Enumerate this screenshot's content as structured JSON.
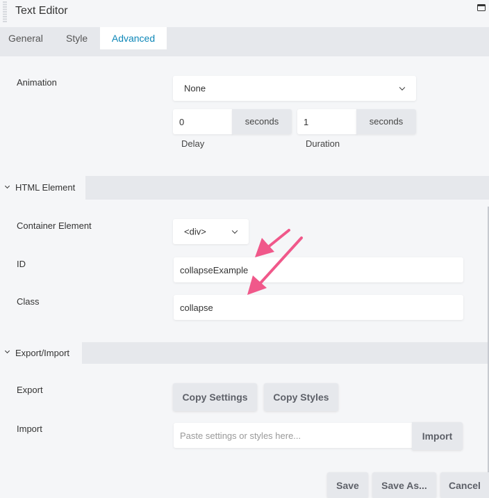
{
  "window": {
    "title": "Text Editor",
    "icons": [
      "drag-handle-icon",
      "window-maximize-icon"
    ]
  },
  "tabs": [
    {
      "label": "General",
      "active": false
    },
    {
      "label": "Style",
      "active": false
    },
    {
      "label": "Advanced",
      "active": true
    }
  ],
  "colors": {
    "accent": "#0e87b8",
    "background": "#f5f6f8",
    "bar": "#e6e8ec",
    "annotation_arrow": "#f0588a"
  },
  "animation": {
    "label": "Animation",
    "select_value": "None",
    "delay": {
      "value": "0",
      "unit": "seconds",
      "label": "Delay"
    },
    "duration": {
      "value": "1",
      "unit": "seconds",
      "label": "Duration"
    }
  },
  "html_element": {
    "section_title": "HTML Element",
    "container": {
      "label": "Container Element",
      "value": "<div>"
    },
    "id": {
      "label": "ID",
      "value": "collapseExample"
    },
    "class": {
      "label": "Class",
      "value": "collapse"
    }
  },
  "export_import": {
    "section_title": "Export/Import",
    "export_label": "Export",
    "copy_settings": "Copy Settings",
    "copy_styles": "Copy Styles",
    "import_label": "Import",
    "import_placeholder": "Paste settings or styles here...",
    "import_button": "Import"
  },
  "footer": {
    "save": "Save",
    "save_as": "Save As...",
    "cancel": "Cancel"
  },
  "annotations": [
    {
      "type": "arrow",
      "points_to": "id-field"
    },
    {
      "type": "arrow",
      "points_to": "class-field"
    }
  ]
}
